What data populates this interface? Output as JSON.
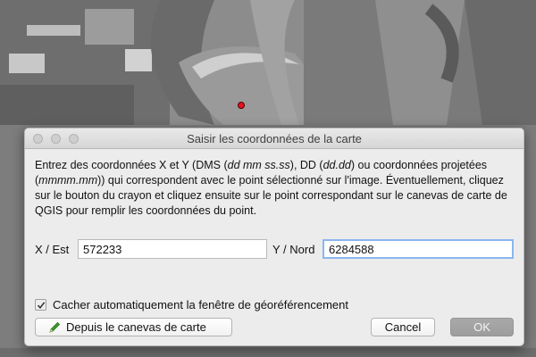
{
  "dialog": {
    "title": "Saisir les coordonnées de la carte",
    "description": {
      "p1": "Entrez des coordonnées X et Y (DMS (",
      "dms_format": "dd mm ss.ss",
      "p2": "), DD (",
      "dd_format": "dd.dd",
      "p3": ") ou coordonnées projetées (",
      "proj_format": "mmmm.mm",
      "p4": ")) qui correspondent avec le point sélectionné sur l'image. Éventuellement, cliquez sur le bouton du crayon et cliquez ensuite sur le point correspondant sur le canevas de carte de QGIS pour remplir les coordonnées du point."
    },
    "x_label": "X / Est",
    "x_value": "572233",
    "y_label": "Y / Nord",
    "y_value": "6284588",
    "auto_hide_label": "Cacher automatiquement la fenêtre de géoréférencement",
    "auto_hide_checked": true,
    "from_canvas_label": "Depuis le canevas de carte",
    "cancel_label": "Cancel",
    "ok_label": "OK"
  },
  "colors": {
    "gcp_point": "#e0141d",
    "focus_ring": "#8bb6ee",
    "pencil": "#3f9b2f"
  },
  "icons": [
    "pencil-icon",
    "checkmark-icon"
  ]
}
